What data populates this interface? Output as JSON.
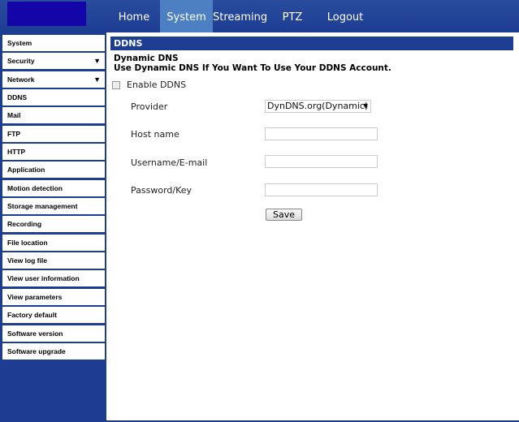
{
  "nav": [
    "Home",
    "System",
    "Streaming",
    "PTZ",
    "Logout"
  ],
  "sidebar": [
    "System",
    "Security",
    "Network",
    "DDNS",
    "Mail",
    "FTP",
    "HTTP",
    "Application",
    "Motion detection",
    "Storage management",
    "Recording",
    "File location",
    "View log file",
    "View user information",
    "View parameters",
    "Factory default",
    "Software version",
    "Software upgrade"
  ],
  "panel": {
    "title": "DDNS",
    "heading": "Dynamic DNS",
    "description": "Use Dynamic DNS If You Want To Use Your DDNS Account.",
    "enable_label": "Enable DDNS",
    "provider_label": "Provider",
    "provider_value": "DynDNS.org(Dynamic)",
    "host_label": "Host name",
    "user_label": "Username/E-mail",
    "pass_label": "Password/Key",
    "save_label": "Save"
  }
}
